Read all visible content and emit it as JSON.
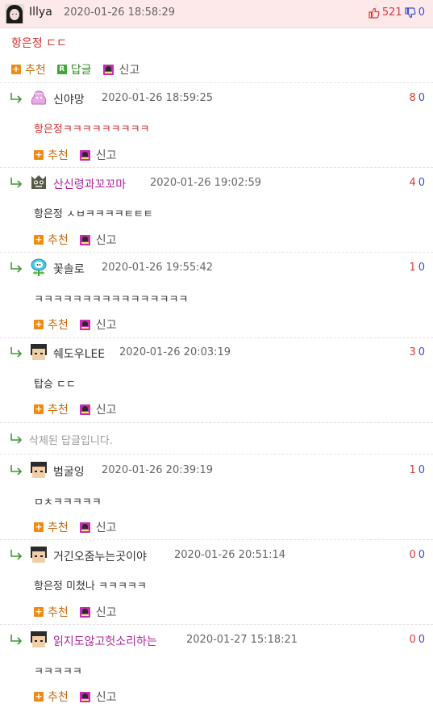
{
  "main": {
    "user": "Illya",
    "timestamp": "2020-01-26 18:58:29",
    "up": "521",
    "down": "0",
    "text": "항은정 ㄷㄷ",
    "recommend_label": "추천",
    "reply_label": "답글",
    "report_label": "신고"
  },
  "replies": [
    {
      "user": "신야망",
      "timestamp": "2020-01-26 18:59:25",
      "up": "8",
      "down": "0",
      "text": "항은정ㅋㅋㅋㅋㅋㅋㅋㅋㅋ",
      "recommend_label": "추천",
      "report_label": "신고",
      "user_color": "#333333",
      "text_color": "#d12b2b",
      "avatar": "pink-blob-icon"
    },
    {
      "user": "산신령과꼬꼬마",
      "timestamp": "2020-01-26 19:02:59",
      "up": "4",
      "down": "0",
      "text": "항은정 ㅅㅂㅋㅋㅋㅋㅌㅌㅌ",
      "recommend_label": "추천",
      "report_label": "신고",
      "user_color": "#b0269e",
      "text_color": "#333333",
      "avatar": "green-skull-icon"
    },
    {
      "user": "꽃솔로",
      "timestamp": "2020-01-26 19:55:42",
      "up": "1",
      "down": "0",
      "text": "ㅋㅋㅋㅋㅋㅋㅋㅋㅋㅋㅋㅋㅋㅋㅋㅋ",
      "recommend_label": "추천",
      "report_label": "신고",
      "user_color": "#333333",
      "text_color": "#333333",
      "avatar": "flower-icon"
    },
    {
      "user": "쉐도우LEE",
      "timestamp": "2020-01-26 20:03:19",
      "up": "3",
      "down": "0",
      "text": "탑승 ㄷㄷ",
      "recommend_label": "추천",
      "report_label": "신고",
      "user_color": "#333333",
      "text_color": "#333333",
      "avatar": "pixel-face-icon"
    },
    {
      "user": "범굴잉",
      "timestamp": "2020-01-26 20:39:19",
      "up": "1",
      "down": "0",
      "text": "ㅁㅊㅋㅋㅋㅋㅋ",
      "recommend_label": "추천",
      "report_label": "신고",
      "user_color": "#333333",
      "text_color": "#333333",
      "avatar": "pixel-face-icon"
    },
    {
      "user": "거긴오줌누는곳이야",
      "timestamp": "2020-01-26 20:51:14",
      "up": "0",
      "down": "0",
      "text": "항은정 미쳤나 ㅋㅋㅋㅋㅋ",
      "recommend_label": "추천",
      "report_label": "신고",
      "user_color": "#333333",
      "text_color": "#333333",
      "avatar": "pixel-face-icon"
    },
    {
      "user": "읽지도않고헛소리하는",
      "timestamp": "2020-01-27 15:18:21",
      "up": "0",
      "down": "0",
      "text": "ㅋㅋㅋㅋㅋ",
      "recommend_label": "추천",
      "report_label": "신고",
      "user_color": "#b0269e",
      "text_color": "#333333",
      "avatar": "pixel-face-icon"
    }
  ],
  "deleted_text": "삭제된 답글입니다.",
  "colors": {
    "upvote": "#e03a3a",
    "downvote": "#3d4fd6",
    "header_bg": "#fde9ea",
    "arrow": "#3a9a2f"
  }
}
